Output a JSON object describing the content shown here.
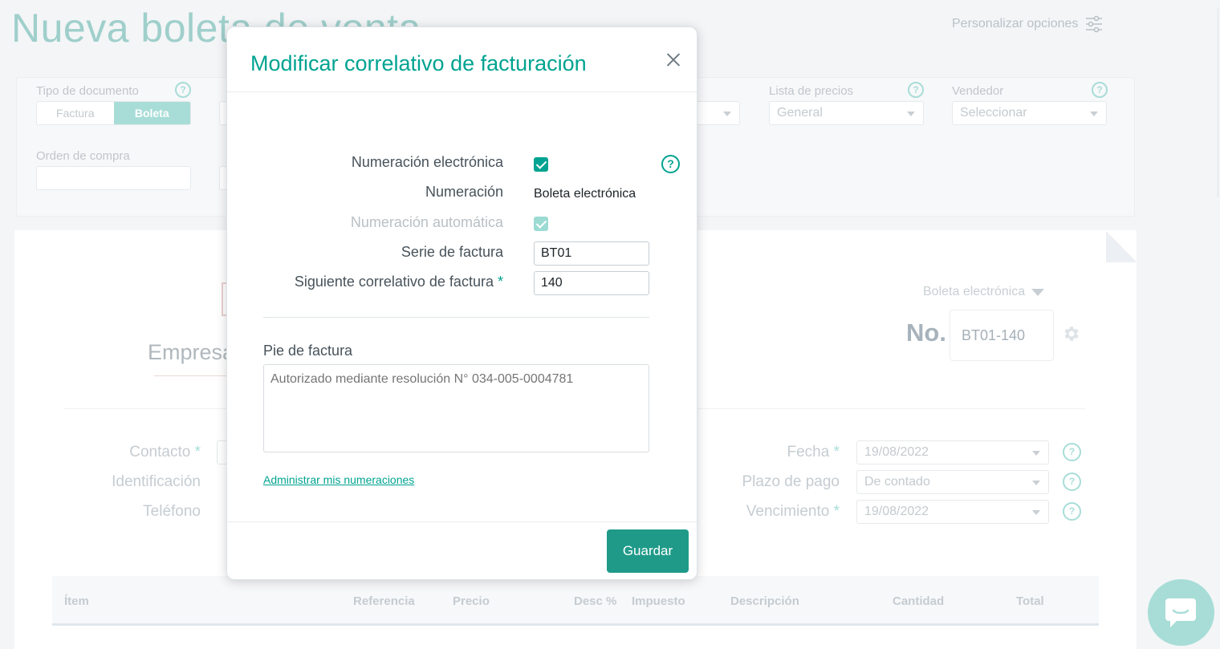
{
  "background": {
    "page_title": "Nueva boleta de venta",
    "personalize_label": "Personalizar opciones",
    "doc_type": {
      "label": "Tipo de documento",
      "options": [
        "Factura",
        "Boleta"
      ],
      "selected": "Boleta"
    },
    "price_list": {
      "label": "Lista de precios",
      "value": "General"
    },
    "seller": {
      "label": "Vendedor",
      "placeholder": "Seleccionar"
    },
    "purchase_order": {
      "label": "Orden de compra"
    },
    "company_name": "Empresa",
    "document_kind": "Boleta electrónica",
    "number_prefix": "No.",
    "number_value": "BT01-140",
    "left_fields": [
      {
        "label": "Contacto",
        "required": "*"
      },
      {
        "label": "Identificación",
        "required": ""
      },
      {
        "label": "Teléfono",
        "required": ""
      }
    ],
    "right_fields": [
      {
        "label": "Fecha",
        "required": "*",
        "value": "19/08/2022"
      },
      {
        "label": "Plazo de pago",
        "required": "",
        "value": "De contado"
      },
      {
        "label": "Vencimiento",
        "required": "*",
        "value": "19/08/2022"
      }
    ],
    "table_headers": [
      "Ítem",
      "Referencia",
      "Precio",
      "Desc %",
      "Impuesto",
      "Descripción",
      "Cantidad",
      "Total"
    ]
  },
  "modal": {
    "title": "Modificar correlativo de facturación",
    "electronic_numbering": {
      "label": "Numeración electrónica",
      "checked": true
    },
    "numbering": {
      "label": "Numeración",
      "value": "Boleta electrónica"
    },
    "auto_numbering": {
      "label": "Numeración automática",
      "checked": true,
      "disabled": true
    },
    "series": {
      "label": "Serie de factura",
      "value": "BT01"
    },
    "next_number": {
      "label": "Siguiente correlativo de factura",
      "required": "*",
      "value": "140"
    },
    "footer": {
      "label": "Pie de factura",
      "placeholder": "Autorizado mediante resolución N° 034-005-0004781"
    },
    "manage_link": "Administrar mis numeraciones",
    "save_label": "Guardar",
    "help_glyph": "?"
  },
  "colors": {
    "accent": "#00a391",
    "save_button": "#1f9a89",
    "accent_faded": "#a8ddd7"
  },
  "icons": [
    "sliders-icon",
    "help-icon",
    "close-icon",
    "check-icon",
    "gear-icon",
    "chat-icon",
    "dropdown-arrow-icon"
  ]
}
